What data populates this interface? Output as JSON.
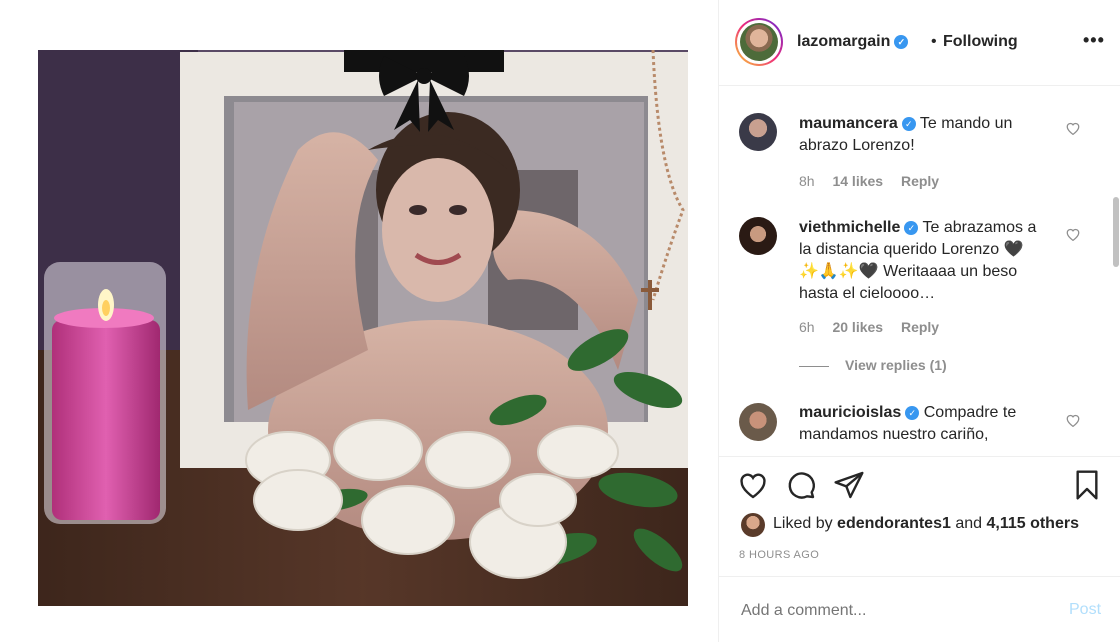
{
  "header": {
    "username": "lazomargain",
    "dot": "•",
    "follow_status": "Following",
    "more": "•••"
  },
  "comments": [
    {
      "username": "maumancera",
      "text": "Te mando un abrazo Lorenzo!",
      "time": "8h",
      "likes": "14 likes",
      "reply": "Reply"
    },
    {
      "username": "viethmichelle",
      "text": "Te abrazamos a la distancia querido Lorenzo 🖤 ✨🙏✨🖤 Weritaaaa un beso hasta el cieloooo…",
      "time": "6h",
      "likes": "20 likes",
      "reply": "Reply"
    },
    {
      "username": "mauricioislas",
      "text": "Compadre te mandamos nuestro cariño,"
    }
  ],
  "view_replies": "View replies (1)",
  "actions": {
    "liked_prefix": "Liked by",
    "liked_user": "edendorantes1",
    "liked_and": "and",
    "liked_count": "4,115 others",
    "time_ago": "8 HOURS AGO"
  },
  "add_comment": {
    "placeholder": "Add a comment...",
    "post": "Post"
  },
  "icons": {
    "heart": "heart-icon",
    "comment": "comment-icon",
    "share": "share-icon",
    "bookmark": "bookmark-icon",
    "verified": "verified-icon"
  },
  "colors": {
    "verified": "#3897f0",
    "post_disabled": "#b2dffc",
    "muted": "#8e8e8e"
  }
}
